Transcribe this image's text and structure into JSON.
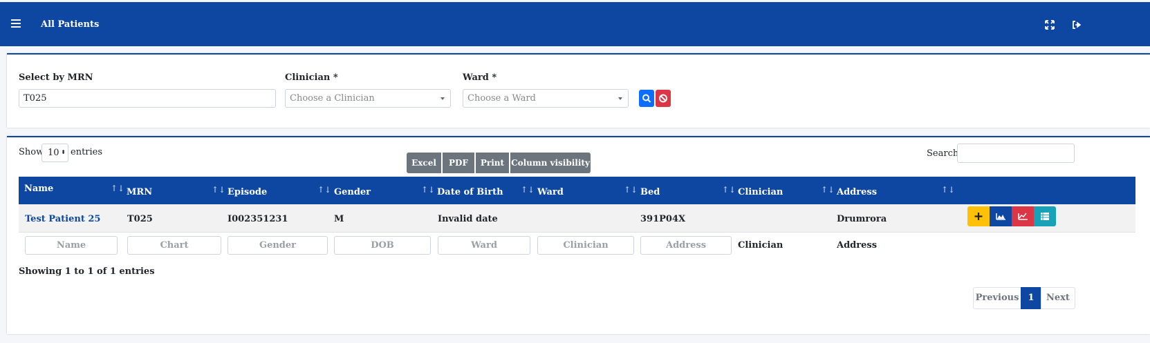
{
  "header": {
    "title": "All Patients",
    "menu_icon": "hamburger-icon",
    "fullscreen_icon": "expand-icon",
    "logout_icon": "sign-out-icon"
  },
  "filters": {
    "mrn_label": "Select by MRN",
    "mrn_value": "T025",
    "clinician_label": "Clinician *",
    "clinician_placeholder": "Choose a Clinician",
    "ward_label": "Ward *",
    "ward_placeholder": "Choose a Ward"
  },
  "table_controls": {
    "show_label": "Show",
    "entries_value": "10",
    "entries_label": "entries",
    "buttons": [
      "Excel",
      "PDF",
      "Print",
      "Column visibility"
    ],
    "search_label": "Search:"
  },
  "table": {
    "columns": [
      "Name",
      "MRN",
      "Episode",
      "Gender",
      "Date of Birth",
      "Ward",
      "Bed",
      "Clinician",
      "Address"
    ],
    "rows": [
      {
        "name": "Test Patient 25",
        "mrn": "T025",
        "episode": "I002351231",
        "gender": "M",
        "dob": "Invalid date",
        "ward": "",
        "bed": "391P04X",
        "clinician": "",
        "address": "Drumrora"
      }
    ],
    "filter_placeholders": [
      "Name",
      "Chart",
      "Gender",
      "DOB",
      "Ward",
      "Clinician",
      "Address"
    ],
    "filter_static": [
      "Clinician",
      "Address"
    ]
  },
  "footer": {
    "info": "Showing 1 to 1 of 1 entries",
    "previous": "Previous",
    "page": "1",
    "next": "Next"
  },
  "colors": {
    "primary": "#0d47a1",
    "grey_button": "#6c757d",
    "warning": "#ffc107",
    "danger": "#dc3545",
    "info": "#17a2b8",
    "search_btn": "#0d6efd"
  }
}
